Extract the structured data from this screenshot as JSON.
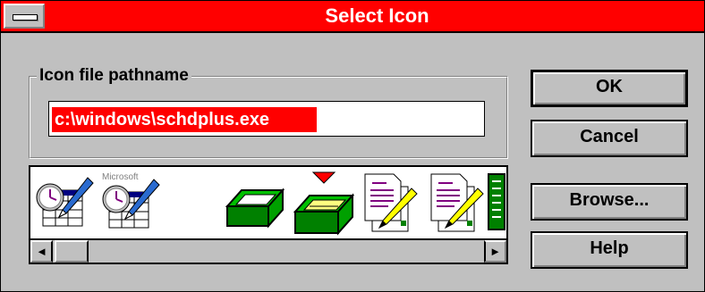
{
  "dialog": {
    "title": "Select Icon",
    "title_bar_color": "#ff0000"
  },
  "path_group": {
    "label": "Icon file pathname",
    "value": "c:\\windows\\schdplus.exe"
  },
  "icon_list": {
    "icons": [
      "schedule-plus-icon",
      "microsoft-schedule-plus-icon",
      "green-tray-icon",
      "green-tray-arrow-icon",
      "document-pen-icon",
      "document-pen-icon-2",
      "green-book-icon"
    ],
    "icon_caption": "Microsoft",
    "scroll_left": "◄",
    "scroll_right": "►"
  },
  "buttons": {
    "ok": "OK",
    "cancel": "Cancel",
    "browse": "Browse...",
    "help": "Help"
  }
}
